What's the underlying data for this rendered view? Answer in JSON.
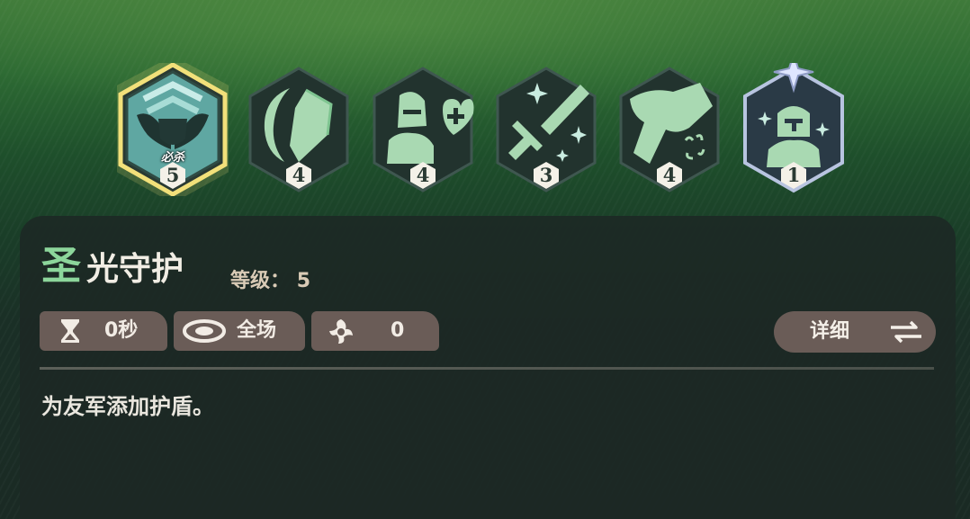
{
  "skills": [
    {
      "icon": "wings-shield-icon",
      "level": "5",
      "tag": "必杀",
      "selected": true
    },
    {
      "icon": "moon-blade-icon",
      "level": "4"
    },
    {
      "icon": "knight-heal-icon",
      "level": "4"
    },
    {
      "icon": "sword-spark-icon",
      "level": "3"
    },
    {
      "icon": "fist-angry-icon",
      "level": "4"
    },
    {
      "icon": "knight-star-icon",
      "level": "1"
    }
  ],
  "detail": {
    "title_first": "圣",
    "title_rest": "光守护",
    "level_label": "等级：",
    "level_value": "5",
    "cooldown": "0秒",
    "range": "全场",
    "energy": "0",
    "detail_button": "详细",
    "description": "为友军添加护盾。"
  },
  "colors": {
    "accent_green": "#8cd69b",
    "selected_border": "#f2e07a",
    "chip_bg": "#6a5c57",
    "icon_fill": "#a9d9b2",
    "hex_dark": "#22332e"
  }
}
